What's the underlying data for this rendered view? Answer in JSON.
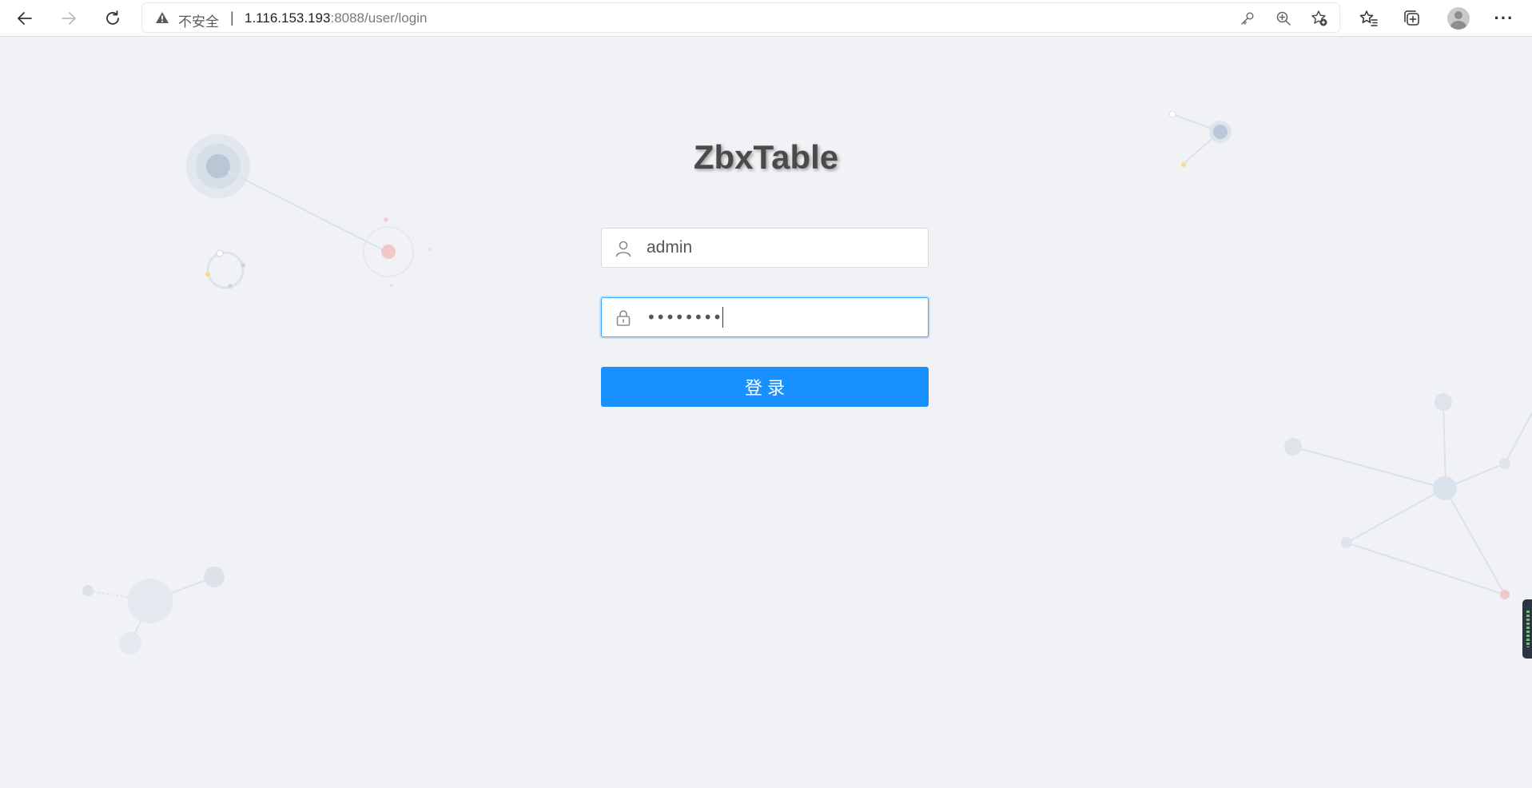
{
  "browser": {
    "nav": {
      "back_icon": "arrow-left-icon",
      "forward_icon": "arrow-right-icon",
      "refresh_icon": "refresh-icon"
    },
    "address_bar": {
      "security_label": "不安全",
      "separator": "|",
      "url_host": "1.116.153.193",
      "url_rest": ":8088/user/login"
    },
    "toolbar_icons": [
      "key-icon",
      "zoom-icon",
      "add-favorite-icon",
      "favorites-icon",
      "collections-icon",
      "profile-avatar",
      "more-icon"
    ],
    "more_label": "···"
  },
  "login": {
    "title": "ZbxTable",
    "username": {
      "value": "admin",
      "icon": "user-icon"
    },
    "password": {
      "masked_value": "••••••••",
      "icon": "lock-icon"
    },
    "submit_label": "登录"
  },
  "colors": {
    "page_background": "#f0f2f5",
    "primary": "#1890ff",
    "title": "#4a4a4a"
  }
}
